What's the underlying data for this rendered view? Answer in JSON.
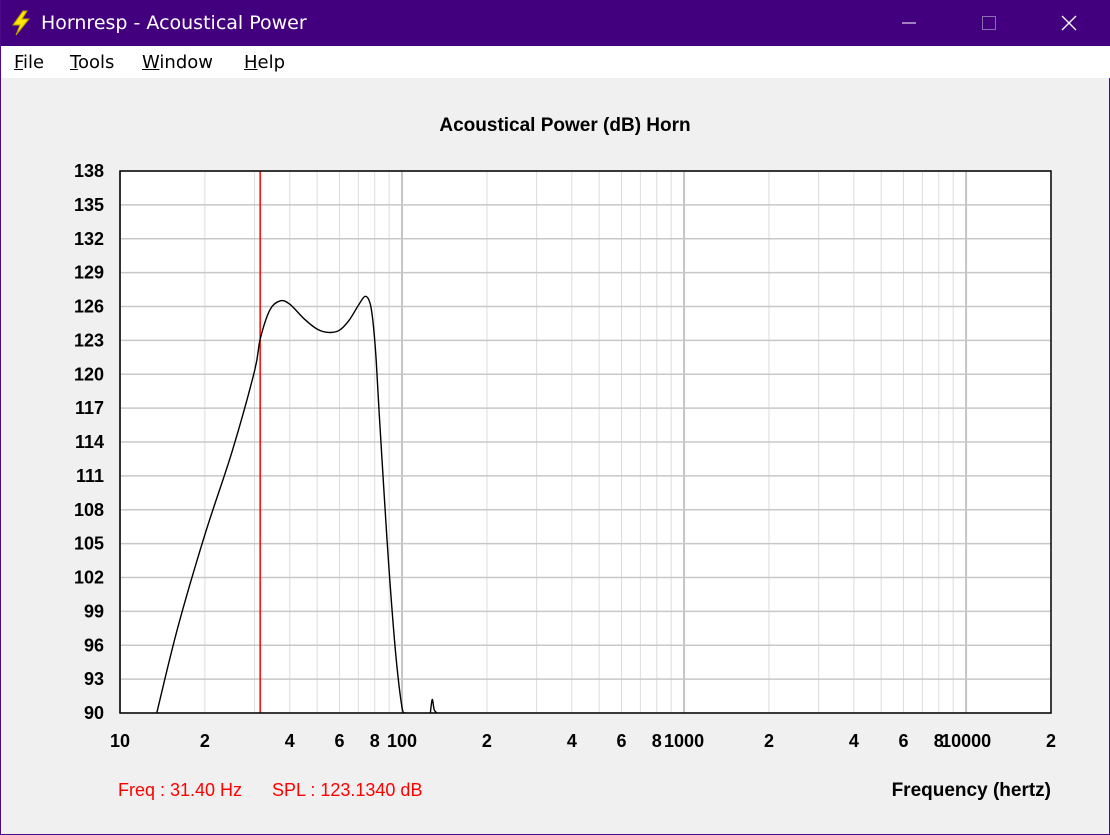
{
  "window": {
    "title": "Hornresp - Acoustical Power",
    "app_icon": "lightning-bolt-icon",
    "controls": {
      "minimize": "minimize-icon",
      "maximize": "maximize-icon",
      "close": "close-icon"
    },
    "titlebar_color": "#42007f"
  },
  "menu": {
    "items": [
      "File",
      "Tools",
      "Window",
      "Help"
    ]
  },
  "readout": {
    "freq": "Freq : 31.40 Hz",
    "spl": "SPL : 123.1340 dB"
  },
  "chart_data": {
    "type": "line",
    "title": "Acoustical Power (dB)   Horn",
    "xlabel": "Frequency (hertz)",
    "ylabel": "",
    "x_scale": "log",
    "xlim": [
      10,
      20000
    ],
    "ylim": [
      90,
      138
    ],
    "grid": true,
    "x_tick_labels": [
      {
        "value": 10,
        "label": "10"
      },
      {
        "value": 20,
        "label": "2"
      },
      {
        "value": 40,
        "label": "4"
      },
      {
        "value": 60,
        "label": "6"
      },
      {
        "value": 80,
        "label": "8"
      },
      {
        "value": 100,
        "label": "100"
      },
      {
        "value": 200,
        "label": "2"
      },
      {
        "value": 400,
        "label": "4"
      },
      {
        "value": 600,
        "label": "6"
      },
      {
        "value": 800,
        "label": "8"
      },
      {
        "value": 1000,
        "label": "1000"
      },
      {
        "value": 2000,
        "label": "2"
      },
      {
        "value": 4000,
        "label": "4"
      },
      {
        "value": 6000,
        "label": "6"
      },
      {
        "value": 8000,
        "label": "8"
      },
      {
        "value": 10000,
        "label": "10000"
      },
      {
        "value": 20000,
        "label": "2"
      }
    ],
    "y_ticks": [
      138,
      135,
      132,
      129,
      126,
      123,
      120,
      117,
      114,
      111,
      108,
      105,
      102,
      99,
      96,
      93,
      90
    ],
    "series": [
      {
        "color": "#000000",
        "x": [
          13.5,
          16,
          20,
          25,
          30,
          31.4,
          34,
          37,
          40,
          45,
          50,
          55,
          60,
          65,
          70,
          74,
          77,
          79,
          81,
          83,
          86,
          90,
          95,
          100,
          103
        ],
        "y": [
          90,
          97.5,
          105.8,
          113.2,
          120.3,
          123.1,
          125.7,
          126.5,
          126.2,
          124.9,
          124.0,
          123.7,
          123.9,
          124.8,
          126.1,
          126.9,
          126.3,
          124.5,
          121.2,
          116.5,
          110.2,
          102.6,
          95.2,
          90.5,
          90
        ]
      },
      {
        "color": "#000000",
        "x": [
          126,
          128,
          130,
          133
        ],
        "y": [
          90,
          91.2,
          90.3,
          90
        ]
      }
    ],
    "marker": {
      "type": "vertical-line",
      "x": 31.4,
      "color": "#ff0000"
    }
  }
}
